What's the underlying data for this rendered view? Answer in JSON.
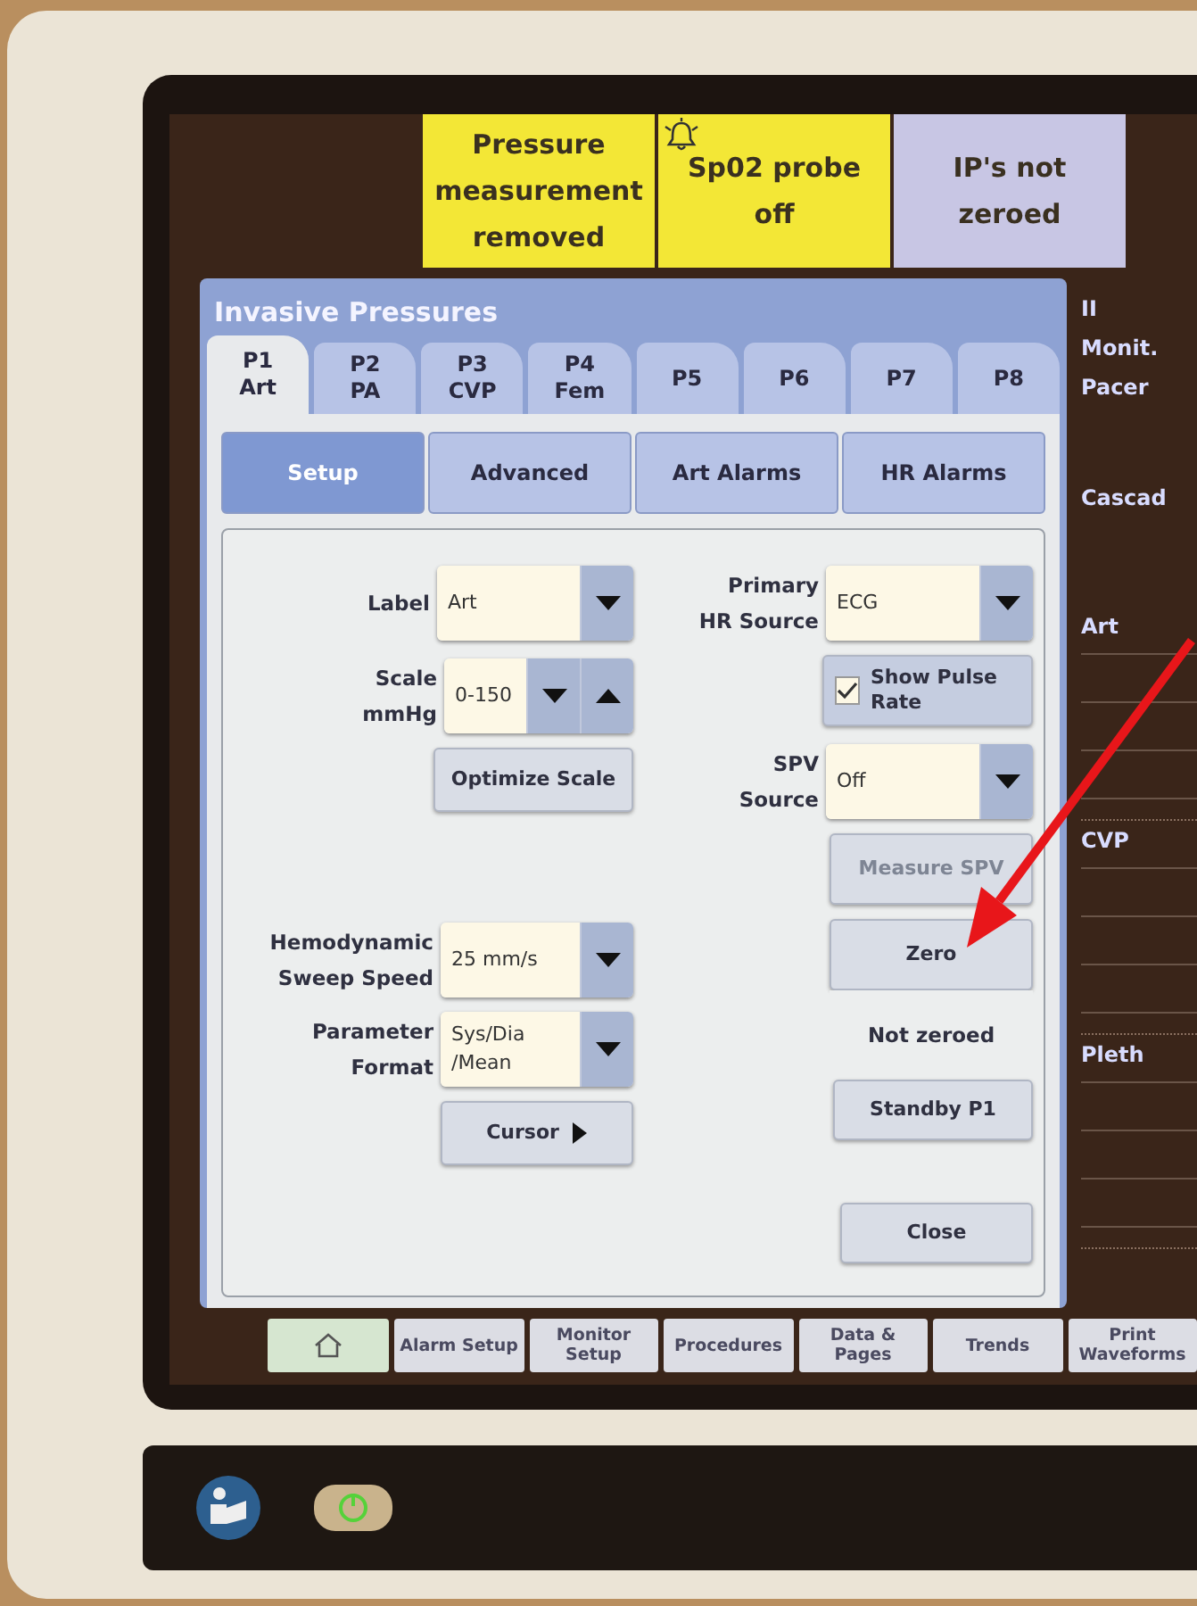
{
  "alarms": [
    {
      "text": "Pressure measurement removed",
      "color": "#f3e736",
      "bell": false
    },
    {
      "text": "Sp02 probe off",
      "color": "#f3e736",
      "bell": true
    },
    {
      "text": "IP's not zeroed",
      "color": "#c8c6e4",
      "bell": false
    }
  ],
  "dialog": {
    "title": "Invasive Pressures",
    "tabs": [
      {
        "label": "P1",
        "sub": "Art",
        "selected": true
      },
      {
        "label": "P2",
        "sub": "PA",
        "selected": false
      },
      {
        "label": "P3",
        "sub": "CVP",
        "selected": false
      },
      {
        "label": "P4",
        "sub": "Fem",
        "selected": false
      },
      {
        "label": "P5",
        "selected": false
      },
      {
        "label": "P6",
        "selected": false
      },
      {
        "label": "P7",
        "selected": false
      },
      {
        "label": "P8",
        "selected": false
      }
    ],
    "subtabs": [
      {
        "label": "Setup",
        "selected": true
      },
      {
        "label": "Advanced",
        "selected": false
      },
      {
        "label": "Art Alarms",
        "selected": false
      },
      {
        "label": "HR Alarms",
        "selected": false
      }
    ],
    "label_field": {
      "label": "Label",
      "value": "Art"
    },
    "scale_field": {
      "label": "Scale mmHg",
      "value": "0-150"
    },
    "optimize_button": "Optimize Scale",
    "sweep_field": {
      "label": "Hemodynamic Sweep Speed",
      "value": "25 mm/s"
    },
    "format_field": {
      "label": "Parameter Format",
      "value": "Sys/Dia /Mean"
    },
    "cursor_button": "Cursor",
    "hr_source_field": {
      "label": "Primary HR Source",
      "value": "ECG"
    },
    "pulse_rate": {
      "label": "Show Pulse Rate",
      "checked": true
    },
    "spv_source_field": {
      "label": "SPV Source",
      "value": "Off"
    },
    "measure_spv": {
      "label": "Measure SPV",
      "disabled": true
    },
    "zero_button": "Zero",
    "zero_status": "Not zeroed",
    "standby_button": "Standby P1",
    "close_button": "Close"
  },
  "side_labels": [
    "II",
    "Monit.",
    "Pacer",
    "Cascad"
  ],
  "waves": [
    "Art",
    "CVP",
    "Pleth"
  ],
  "bottom_bar": [
    {
      "kind": "home",
      "selected": true
    },
    {
      "kind": "text",
      "label": "Alarm Setup",
      "selected": false
    },
    {
      "kind": "text",
      "label": "Monitor Setup",
      "selected": false
    },
    {
      "kind": "text",
      "label": "Procedures",
      "selected": false
    },
    {
      "kind": "text",
      "label": "Data & Pages",
      "selected": false
    },
    {
      "kind": "text",
      "label": "Trends",
      "selected": false
    },
    {
      "kind": "text",
      "label": "Print Waveforms",
      "selected": false
    }
  ]
}
